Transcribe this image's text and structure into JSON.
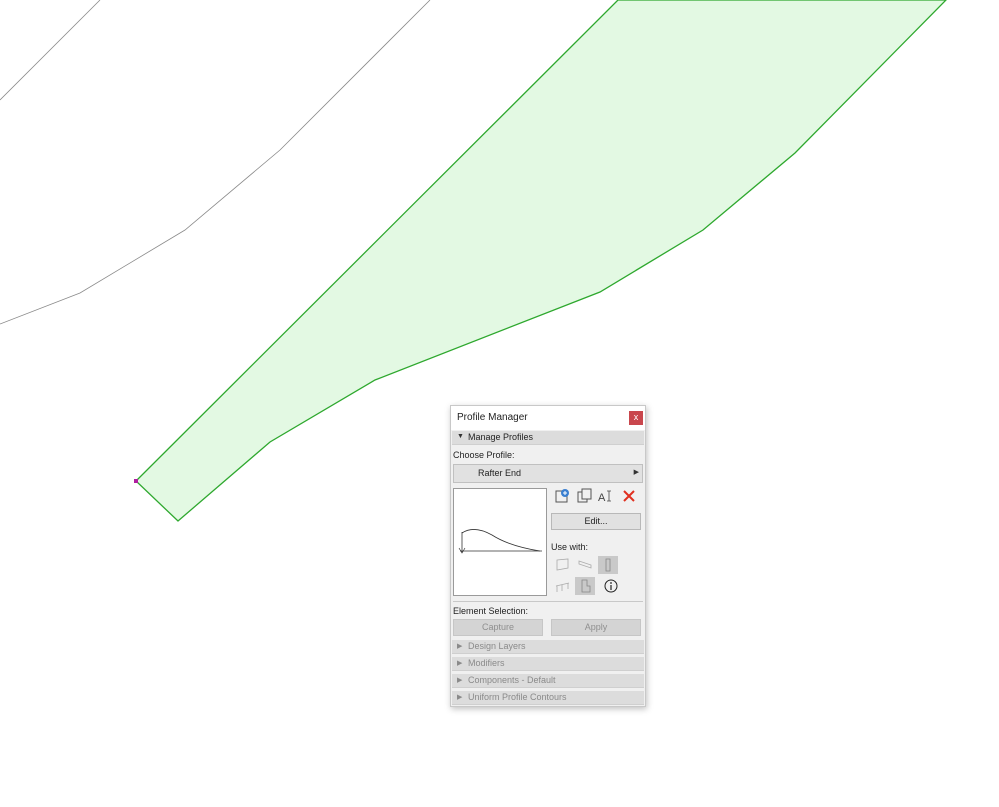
{
  "canvas": {
    "fill_color": "#e3f9e3",
    "outline_color": "#2ea82e",
    "line_color": "#8a8a8a",
    "vertex_color": "#b01ea0"
  },
  "panel": {
    "title": "Profile Manager",
    "close_label": "x",
    "manage_section": {
      "label": "Manage Profiles",
      "expanded": true
    },
    "choose_profile_label": "Choose Profile:",
    "profile_value": "Rafter End",
    "edit_label": "Edit...",
    "use_with_label": "Use with:",
    "element_selection_label": "Element Selection:",
    "capture_label": "Capture",
    "apply_label": "Apply",
    "icons": [
      "new-profile-icon",
      "duplicate-profile-icon",
      "rename-profile-icon",
      "delete-profile-icon"
    ],
    "use_with_icons": [
      "wall-icon",
      "beam-icon",
      "column-icon",
      "railing-icon",
      "object-icon",
      "info-icon"
    ],
    "collapsed_sections": [
      {
        "label": "Design Layers"
      },
      {
        "label": "Modifiers"
      },
      {
        "label": "Components - Default"
      },
      {
        "label": "Uniform Profile Contours"
      }
    ]
  }
}
